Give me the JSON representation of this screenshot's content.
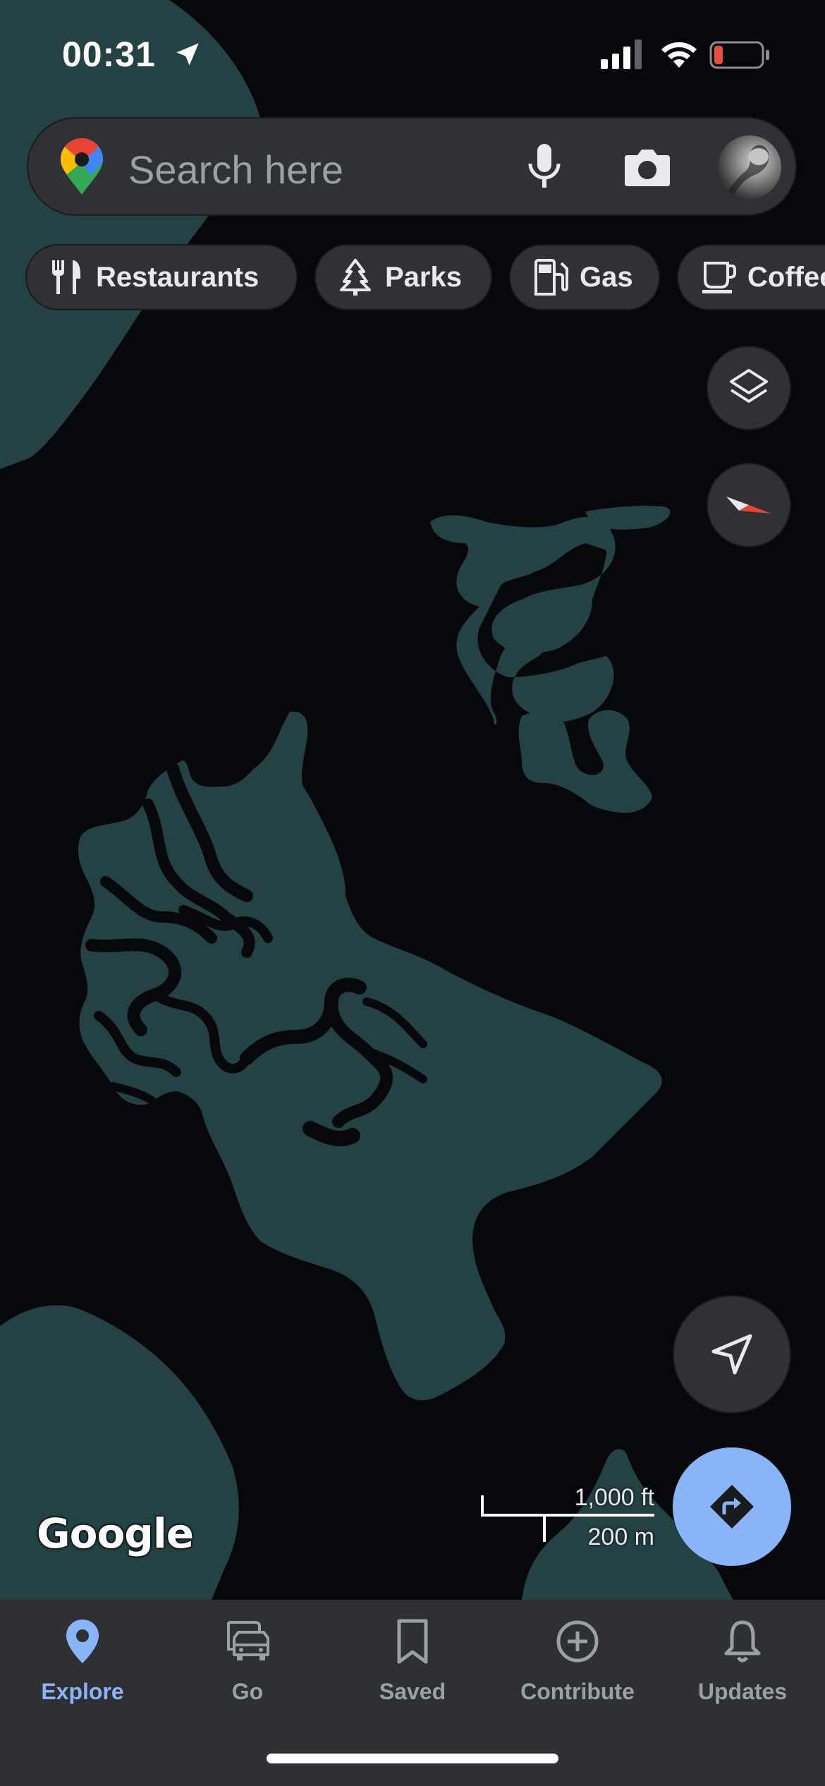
{
  "status_bar": {
    "time": "00:31"
  },
  "search": {
    "placeholder": "Search here"
  },
  "chips": [
    {
      "label": "Restaurants",
      "icon": "fork-knife-icon"
    },
    {
      "label": "Parks",
      "icon": "tree-icon"
    },
    {
      "label": "Gas",
      "icon": "gas-pump-icon"
    },
    {
      "label": "Coffee",
      "icon": "coffee-cup-icon"
    }
  ],
  "map": {
    "attribution": "Google",
    "scale_imperial": "1,000 ft",
    "scale_metric": "200 m",
    "land_color": "#244244",
    "water_color": "#06080c"
  },
  "nav": {
    "items": [
      {
        "label": "Explore",
        "icon": "location-pin-icon",
        "active": true
      },
      {
        "label": "Go",
        "icon": "car-icon",
        "active": false
      },
      {
        "label": "Saved",
        "icon": "bookmark-icon",
        "active": false
      },
      {
        "label": "Contribute",
        "icon": "plus-circle-icon",
        "active": false
      },
      {
        "label": "Updates",
        "icon": "bell-icon",
        "active": false
      }
    ],
    "active_color": "#8ab4f8"
  },
  "colors": {
    "directions_fab": "#8ab4f8",
    "surface": "#303134"
  }
}
